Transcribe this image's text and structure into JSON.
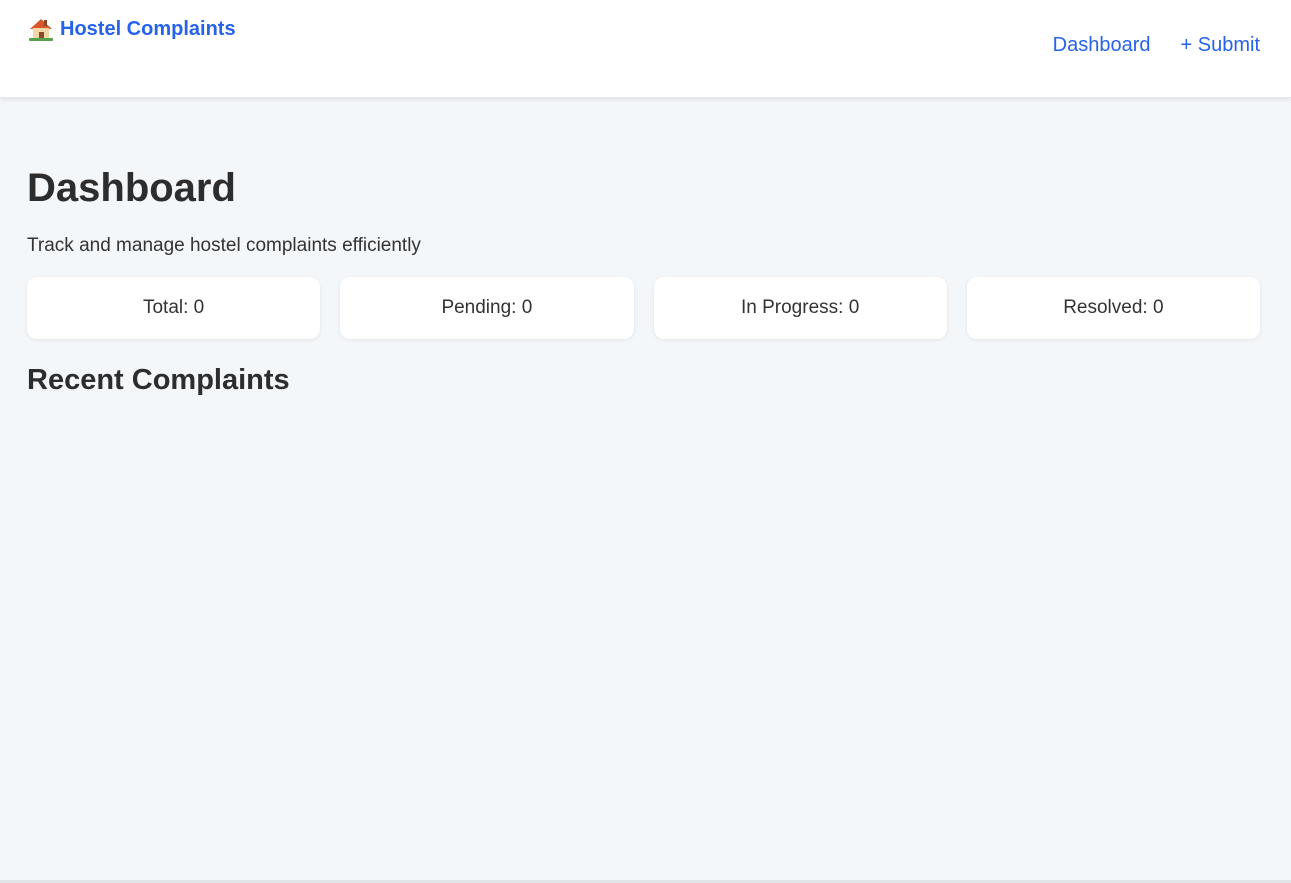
{
  "nav": {
    "brand_label": "Hostel Complaints",
    "brand_icon": "house-icon",
    "links": [
      {
        "label": "Dashboard"
      },
      {
        "label": "+ Submit"
      }
    ]
  },
  "main": {
    "title": "Dashboard",
    "subtitle": "Track and manage hostel complaints efficiently",
    "stats": [
      {
        "label": "Total: 0"
      },
      {
        "label": "Pending: 0"
      },
      {
        "label": "In Progress: 0"
      },
      {
        "label": "Resolved: 0"
      }
    ],
    "recent_title": "Recent Complaints",
    "complaints": []
  },
  "colors": {
    "accent": "#2563eb",
    "background": "#f4f7fa",
    "card": "#ffffff",
    "text": "#2d2d2d"
  }
}
